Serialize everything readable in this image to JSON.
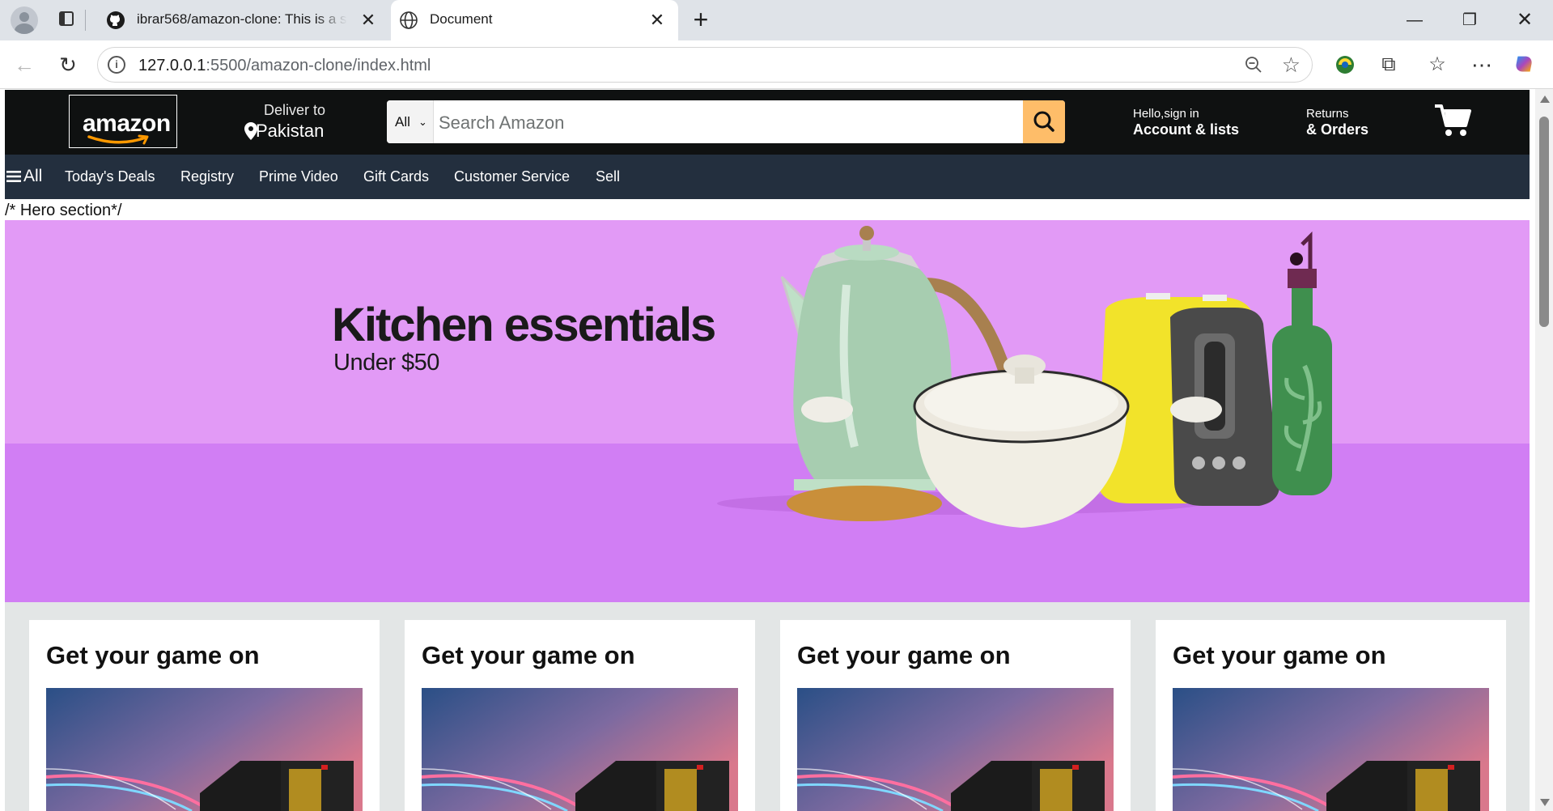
{
  "browser": {
    "tabs": [
      {
        "title": "ibrar568/amazon-clone: This is a s",
        "favicon": "github-icon",
        "active": false
      },
      {
        "title": "Document",
        "favicon": "globe-icon",
        "active": true
      }
    ],
    "url_host": "127.0.0.1",
    "url_rest": ":5500/amazon-clone/index.html"
  },
  "header": {
    "logo_text": "amazon",
    "deliver_line1": "Deliver to",
    "deliver_line2": "Pakistan",
    "search": {
      "category": "All",
      "placeholder": "Search Amazon"
    },
    "account_line1": "Hello,sign in",
    "account_line2": "Account & lists",
    "returns_line1": "Returns",
    "returns_line2": "& Orders"
  },
  "nav": {
    "all_label": "All",
    "items": [
      "Today's Deals",
      "Registry",
      "Prime Video",
      "Gift Cards",
      "Customer Service",
      "Sell"
    ]
  },
  "comment_text": "/* Hero section*/",
  "hero": {
    "title": "Kitchen essentials",
    "subtitle": "Under $50",
    "colors": {
      "top": "#e29af6",
      "bottom": "#d17ef4"
    }
  },
  "cards": [
    {
      "title": "Get your game on"
    },
    {
      "title": "Get your game on"
    },
    {
      "title": "Get your game on"
    },
    {
      "title": "Get your game on"
    }
  ],
  "colors": {
    "header_bg": "#0f1111",
    "nav_bg": "#232f3e",
    "search_button": "#febd69",
    "cards_bg": "#e3e6e6"
  }
}
